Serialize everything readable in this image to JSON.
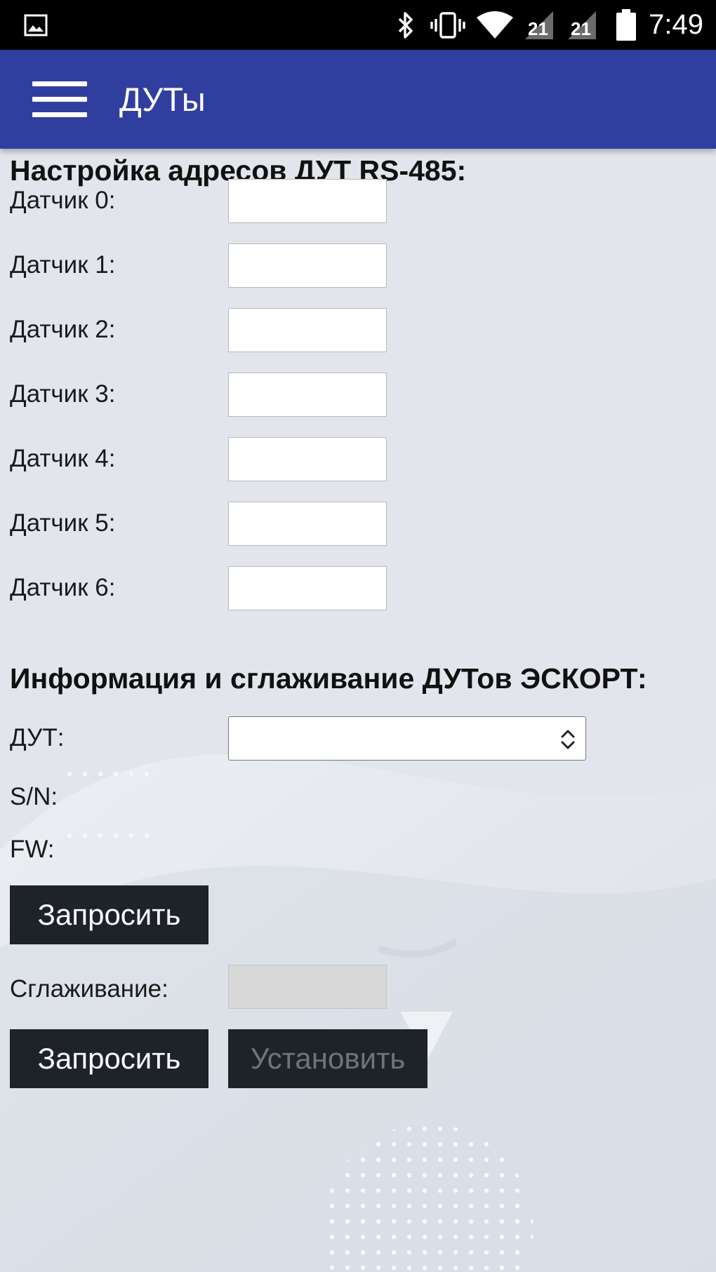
{
  "status_bar": {
    "time": "7:49",
    "icons": [
      "image-icon",
      "bluetooth-icon",
      "vibrate-icon",
      "wifi-icon",
      "signal-icon",
      "signal-icon",
      "battery-icon"
    ],
    "sim_label_1": "21",
    "sim_label_2": "21"
  },
  "app_bar": {
    "title": "ДУТы",
    "menu_icon": "hamburger-menu-icon"
  },
  "rs485_section": {
    "heading": "Настройка адресов ДУТ RS-485:",
    "sensors": [
      {
        "label": "Датчик 0:",
        "value": ""
      },
      {
        "label": "Датчик 1:",
        "value": ""
      },
      {
        "label": "Датчик 2:",
        "value": ""
      },
      {
        "label": "Датчик 3:",
        "value": ""
      },
      {
        "label": "Датчик 4:",
        "value": ""
      },
      {
        "label": "Датчик 5:",
        "value": ""
      },
      {
        "label": "Датчик 6:",
        "value": ""
      }
    ]
  },
  "escort_section": {
    "heading": "Информация и сглаживание ДУТов ЭСКОРТ:",
    "dut_label": "ДУТ:",
    "dut_selected": "",
    "sn_label": "S/N:",
    "fw_label": "FW:",
    "request_info_button": "Запросить",
    "smoothing_label": "Сглаживание:",
    "smoothing_value": "",
    "request_smoothing_button": "Запросить",
    "set_button": "Установить"
  },
  "colors": {
    "app_bar": "#303f9f",
    "background": "#e2e6ec",
    "button": "#1e232a",
    "button_text": "#ffffff",
    "button_disabled_text": "#6f747a",
    "disabled_input": "#d8d8d8"
  }
}
